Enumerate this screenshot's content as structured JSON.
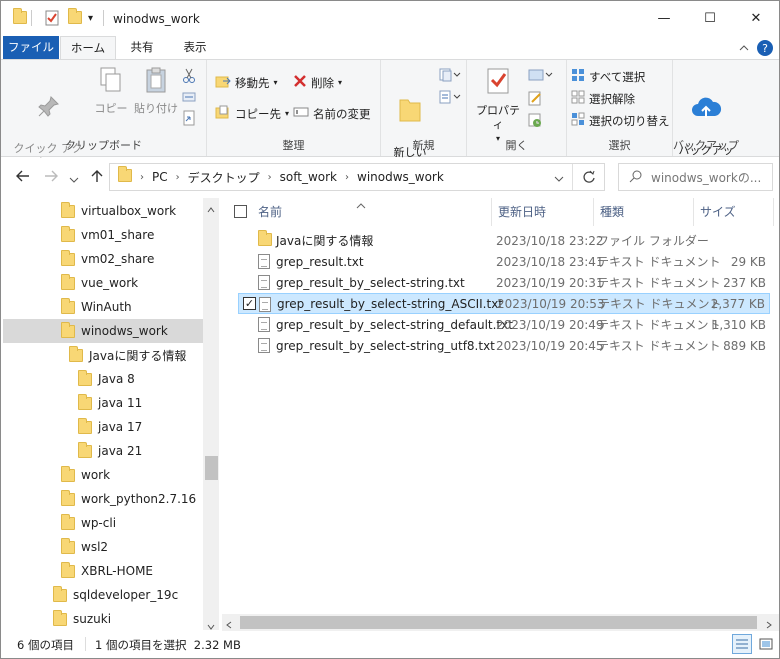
{
  "window": {
    "title": "winodws_work",
    "minimize_glyph": "—",
    "maximize_glyph": "☐",
    "close_glyph": "✕"
  },
  "quick_access": {
    "dropdown_glyph": "▾"
  },
  "tabs": [
    {
      "label": "ファイル"
    },
    {
      "label": "ホーム"
    },
    {
      "label": "共有"
    },
    {
      "label": "表示"
    }
  ],
  "ribbon": {
    "clipboard": {
      "label": "クリップボード",
      "pin": "クイック アクセス\nにピン留めする",
      "copy": "コピー",
      "paste": "貼り付け"
    },
    "organize": {
      "label": "整理",
      "move_to": "移動先",
      "copy_to": "コピー先",
      "delete": "削除",
      "rename": "名前の変更"
    },
    "new": {
      "label": "新規",
      "new_folder": "新しい\nフォルダー"
    },
    "open": {
      "label": "開く",
      "properties": "プロパティ"
    },
    "select": {
      "label": "選択",
      "select_all": "すべて選択",
      "select_none": "選択解除",
      "invert": "選択の切り替え"
    },
    "backup": {
      "label": "バックアップ",
      "start": "バックアップ\nの開始"
    }
  },
  "addressbar": {
    "breadcrumbs": [
      "PC",
      "デスクトップ",
      "soft_work",
      "winodws_work"
    ],
    "search_placeholder": "winodws_workの..."
  },
  "navpane": {
    "items": [
      {
        "label": "virtualbox_work",
        "selected": false
      },
      {
        "label": "vm01_share",
        "selected": false
      },
      {
        "label": "vm02_share",
        "selected": false
      },
      {
        "label": "vue_work",
        "selected": false
      },
      {
        "label": "WinAuth",
        "selected": false
      },
      {
        "label": "winodws_work",
        "selected": true
      },
      {
        "label": "Javaに関する情報",
        "selected": false
      },
      {
        "label": "Java 8",
        "selected": false
      },
      {
        "label": "java 11",
        "selected": false
      },
      {
        "label": "java 17",
        "selected": false
      },
      {
        "label": "java 21",
        "selected": false
      },
      {
        "label": "work",
        "selected": false
      },
      {
        "label": "work_python2.7.16",
        "selected": false
      },
      {
        "label": "wp-cli",
        "selected": false
      },
      {
        "label": "wsl2",
        "selected": false
      },
      {
        "label": "XBRL-HOME",
        "selected": false
      },
      {
        "label": "sqldeveloper_19c",
        "selected": false
      },
      {
        "label": "suzuki",
        "selected": false
      }
    ]
  },
  "filelist": {
    "columns": {
      "name": "名前",
      "date": "更新日時",
      "type": "種類",
      "size": "サイズ"
    },
    "rows": [
      {
        "name": "Javaに関する情報",
        "date": "2023/10/18 23:22",
        "type": "ファイル フォルダー",
        "size": "",
        "icon": "folder-icon",
        "selected": false
      },
      {
        "name": "grep_result.txt",
        "date": "2023/10/18 23:41",
        "type": "テキスト ドキュメント",
        "size": "29 KB",
        "icon": "text-file-icon",
        "selected": false
      },
      {
        "name": "grep_result_by_select-string.txt",
        "date": "2023/10/19 20:31",
        "type": "テキスト ドキュメント",
        "size": "237 KB",
        "icon": "text-file-icon",
        "selected": false
      },
      {
        "name": "grep_result_by_select-string_ASCII.txt",
        "date": "2023/10/19 20:53",
        "type": "テキスト ドキュメント",
        "size": "2,377 KB",
        "icon": "text-file-icon",
        "selected": true
      },
      {
        "name": "grep_result_by_select-string_default.txt",
        "date": "2023/10/19 20:49",
        "type": "テキスト ドキュメント",
        "size": "1,310 KB",
        "icon": "text-file-icon",
        "selected": false
      },
      {
        "name": "grep_result_by_select-string_utf8.txt",
        "date": "2023/10/19 20:45",
        "type": "テキスト ドキュメント",
        "size": "889 KB",
        "icon": "text-file-icon",
        "selected": false
      }
    ]
  },
  "statusbar": {
    "item_count": "6 個の項目",
    "selection": "1 個の項目を選択  2.32 MB"
  },
  "colors": {
    "accent": "#1a5fb4",
    "selection_bg": "#cce8ff",
    "selection_border": "#99d1ff",
    "folder": "#f8d775"
  }
}
